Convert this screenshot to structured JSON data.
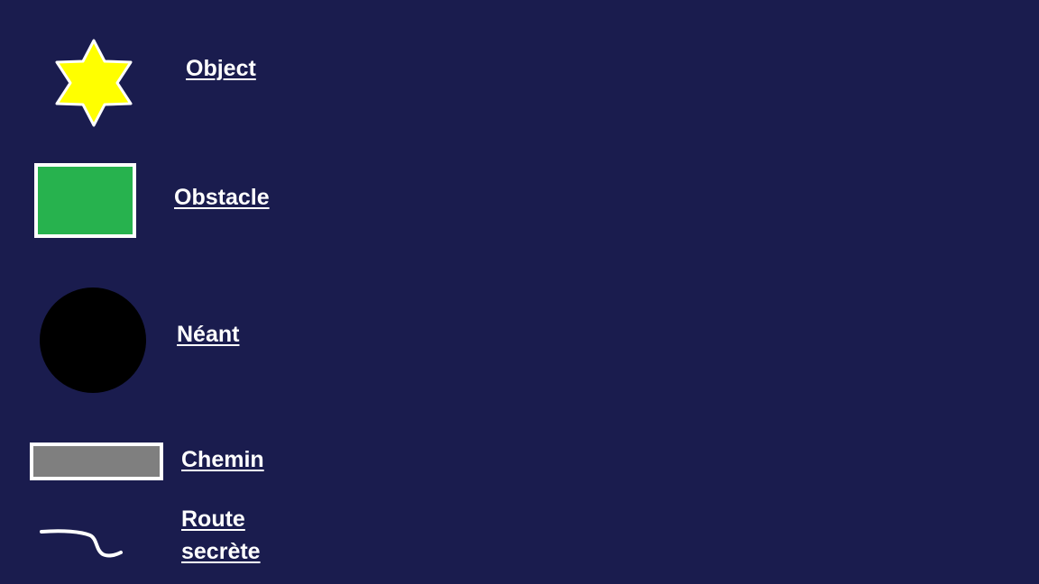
{
  "legend": {
    "items": [
      {
        "symbol": "yellow-star-icon",
        "label": "Object",
        "color": "#ffff00"
      },
      {
        "symbol": "green-rectangle",
        "label": "Obstacle",
        "color": "#27b24e"
      },
      {
        "symbol": "black-circle",
        "label": "Néant",
        "color": "#000000"
      },
      {
        "symbol": "gray-bar",
        "label": "Chemin",
        "color": "#7f7f7f"
      },
      {
        "symbol": "white-curve-line",
        "label_lines": [
          "Route",
          "secrète"
        ],
        "color": "#ffffff"
      }
    ]
  },
  "colors": {
    "background": "#1a1c4e",
    "label_text": "#ffffff",
    "outline": "#ffffff"
  }
}
